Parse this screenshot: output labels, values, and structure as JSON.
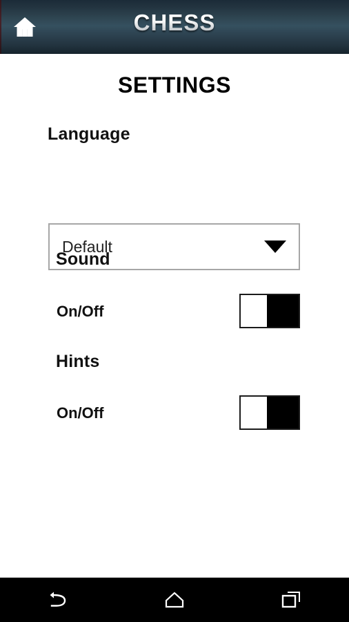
{
  "header": {
    "title": "CHESS",
    "home_icon": "home-icon"
  },
  "page": {
    "title": "SETTINGS"
  },
  "language": {
    "heading": "Language",
    "selected": "Default",
    "options": [
      "Default"
    ],
    "chevron_icon": "chevron-down-icon"
  },
  "sound": {
    "heading": "Sound",
    "label": "On/Off",
    "state": "on"
  },
  "hints": {
    "heading": "Hints",
    "label": "On/Off",
    "state": "on"
  },
  "navbar": {
    "back_icon": "back-arrow-icon",
    "home_icon": "home-outline-icon",
    "recents_icon": "recents-squares-icon"
  },
  "colors": {
    "header_top": "#1b2b38",
    "header_mid": "#35505f",
    "header_bottom": "#16232c",
    "page_background": "#ffffff",
    "text": "#000000",
    "dropdown_border": "#a6a6a6",
    "toggle_track": "#000000",
    "toggle_thumb": "#ffffff",
    "navbar_background": "#000000"
  }
}
